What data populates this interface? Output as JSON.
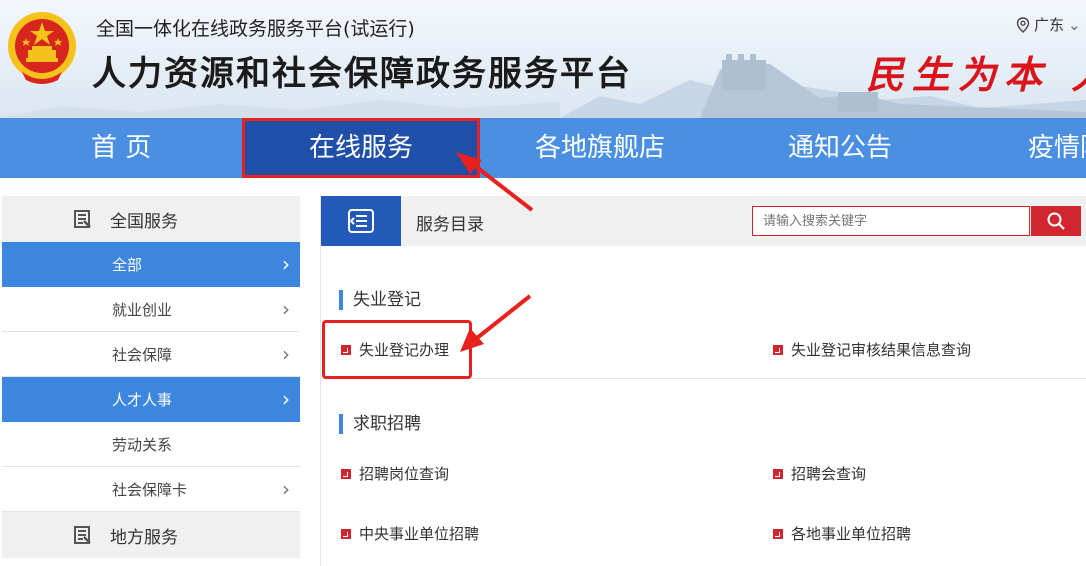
{
  "header": {
    "subtitle": "全国一体化在线政务服务平台(试运行)",
    "title": "人力资源和社会保障政务服务平台",
    "slogan": "民生为本 人",
    "location": "广东"
  },
  "nav": {
    "items": [
      {
        "label": "首 页"
      },
      {
        "label": "在线服务",
        "active": true
      },
      {
        "label": "各地旗舰店"
      },
      {
        "label": "通知公告"
      },
      {
        "label": "疫情防"
      }
    ]
  },
  "sidebar": {
    "national": "全国服务",
    "items": [
      {
        "label": "全部",
        "active": true,
        "chevron": true
      },
      {
        "label": "就业创业",
        "active": false,
        "chevron": true
      },
      {
        "label": "社会保障",
        "active": false,
        "chevron": true
      },
      {
        "label": "人才人事",
        "active": true,
        "chevron": true
      },
      {
        "label": "劳动关系",
        "active": false,
        "chevron": false
      },
      {
        "label": "社会保障卡",
        "active": false,
        "chevron": true
      }
    ],
    "local": "地方服务"
  },
  "main": {
    "catalog_title": "服务目录",
    "search_placeholder": "请输入搜索关键字",
    "sections": [
      {
        "title": "失业登记",
        "links": [
          "失业登记办理",
          "失业登记审核结果信息查询"
        ]
      },
      {
        "title": "求职招聘",
        "links": [
          "招聘岗位查询",
          "招聘会查询",
          "中央事业单位招聘",
          "各地事业单位招聘"
        ]
      }
    ]
  },
  "colors": {
    "nav_bg": "#4a8fe2",
    "nav_active": "#1f4fa8",
    "sidebar_active": "#3d86df",
    "accent_red": "#d2262e",
    "annotation_red": "#e8211f"
  }
}
